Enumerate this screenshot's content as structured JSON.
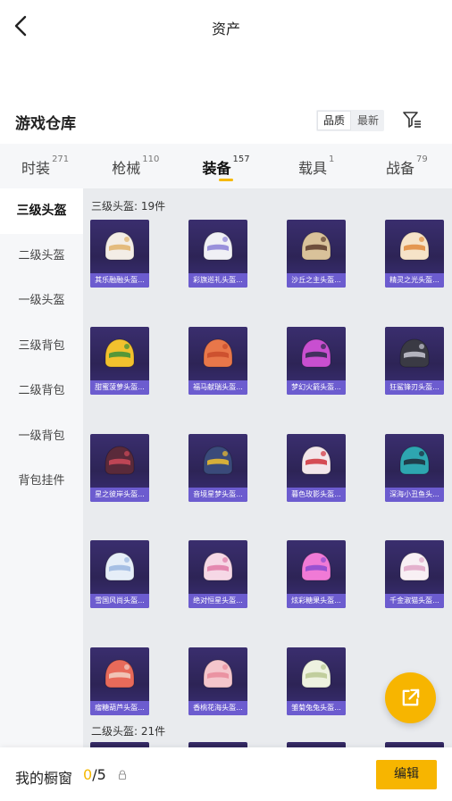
{
  "header": {
    "title": "资产"
  },
  "warehouse": {
    "title": "游戏仓库",
    "sort_options": [
      "品质",
      "最新"
    ],
    "active_sort": "品质"
  },
  "tabs": [
    {
      "label": "时装",
      "count": "271"
    },
    {
      "label": "枪械",
      "count": "110"
    },
    {
      "label": "装备",
      "count": "157"
    },
    {
      "label": "载具",
      "count": "1"
    },
    {
      "label": "战备",
      "count": "79"
    }
  ],
  "active_tab": "装备",
  "sidenav": {
    "items": [
      "三级头盔",
      "二级头盔",
      "一级头盔",
      "三级背包",
      "二级背包",
      "一级背包",
      "背包挂件"
    ],
    "active": "三级头盔"
  },
  "sections": [
    {
      "title": "三级头盔: 19件",
      "items": [
        {
          "name": "其乐融融头盔...",
          "color": "#f3ede6",
          "accent": "#e0b26a"
        },
        {
          "name": "彩旗巡礼头盔...",
          "color": "#f0f0f5",
          "accent": "#8a7fd6"
        },
        {
          "name": "沙丘之主头盔...",
          "color": "#d9c29a",
          "accent": "#5a3b2c"
        },
        {
          "name": "精灵之光头盔...",
          "color": "#f6e3c8",
          "accent": "#e08a3c"
        },
        {
          "name": "甜蜜菠萝头盔...",
          "color": "#f2c12e",
          "accent": "#3b8f3a"
        },
        {
          "name": "福马献瑞头盔...",
          "color": "#e8774a",
          "accent": "#c84a2a"
        },
        {
          "name": "梦幻火箭头盔...",
          "color": "#c84fd0",
          "accent": "#2a2a4a"
        },
        {
          "name": "狂鲨锋刃头盔...",
          "color": "#3a3a44",
          "accent": "#c9c9d4"
        },
        {
          "name": "星之彼岸头盔...",
          "color": "#5a2a3a",
          "accent": "#d04a5a"
        },
        {
          "name": "音境星梦头盔...",
          "color": "#3a4a7a",
          "accent": "#f2c12e"
        },
        {
          "name": "暮色玫影头盔...",
          "color": "#f2e6ea",
          "accent": "#d0303a"
        },
        {
          "name": "深海小丑鱼头...",
          "color": "#2ea6b0",
          "accent": "#1d2a3a"
        },
        {
          "name": "雪国风尚头盔...",
          "color": "#e6eef8",
          "accent": "#9ab6e0"
        },
        {
          "name": "绝对恒星头盔...",
          "color": "#f6d8e6",
          "accent": "#e07aa6"
        },
        {
          "name": "炫彩糖果头盔...",
          "color": "#f07ad6",
          "accent": "#8a4ad0"
        },
        {
          "name": "千金淑猫头盔...",
          "color": "#f8f0f4",
          "accent": "#e0a6c6"
        },
        {
          "name": "瘤糖葫芦头盔...",
          "color": "#e86a5a",
          "accent": "#f2d2c6"
        },
        {
          "name": "香桃花海头盔...",
          "color": "#f4c6cc",
          "accent": "#e88a9a"
        },
        {
          "name": "雏菊兔兔头盔...",
          "color": "#eef2e0",
          "accent": "#b8c890"
        }
      ]
    },
    {
      "title": "二级头盔: 21件"
    }
  ],
  "bottom": {
    "label": "我的橱窗",
    "current": "0",
    "total": "/5",
    "edit_label": "编辑"
  },
  "icons": {
    "back": "chevron-left-icon",
    "filter": "filter-icon",
    "lock": "lock-icon",
    "share": "external-link-icon"
  },
  "colors": {
    "accent": "#f7b500",
    "card_bg": "#2d2456",
    "card_label_bg": "#6c5ccf",
    "grid_bg": "#e9ebee",
    "nav_bg": "#f6f7f9"
  }
}
